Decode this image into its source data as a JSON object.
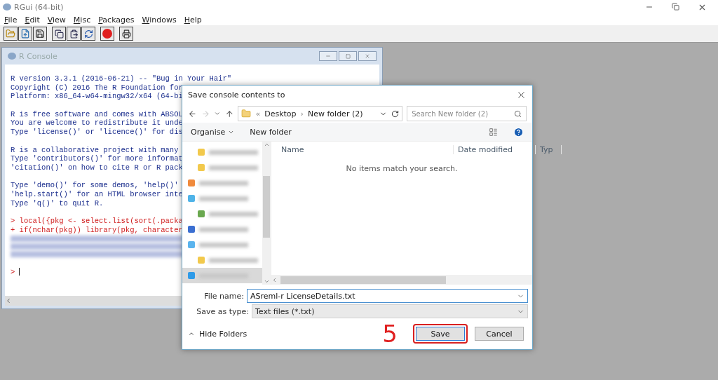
{
  "app_window": {
    "title": "RGui (64-bit)"
  },
  "menu": [
    "File",
    "Edit",
    "View",
    "Misc",
    "Packages",
    "Windows",
    "Help"
  ],
  "toolbar": [
    {
      "kind": "open"
    },
    {
      "kind": "load"
    },
    {
      "kind": "save"
    },
    {
      "kind": "copy"
    },
    {
      "kind": "paste"
    },
    {
      "kind": "refresh"
    },
    {
      "kind": "stop"
    },
    {
      "kind": "print"
    }
  ],
  "console": {
    "title": "R Console",
    "lines": [
      {
        "kind": "output",
        "text": "R version 3.3.1 (2016-06-21) -- \"Bug in Your Hair\""
      },
      {
        "kind": "output",
        "text": "Copyright (C) 2016 The R Foundation for"
      },
      {
        "kind": "output",
        "text": "Platform: x86_64-w64-mingw32/x64 (64-bi"
      },
      {
        "kind": "blank"
      },
      {
        "kind": "output",
        "text": "R is free software and comes with ABSOL"
      },
      {
        "kind": "output",
        "text": "You are welcome to redistribute it unde"
      },
      {
        "kind": "output",
        "text": "Type 'license()' or 'licence()' for dis"
      },
      {
        "kind": "blank"
      },
      {
        "kind": "output",
        "text": "R is a collaborative project with many"
      },
      {
        "kind": "output",
        "text": "Type 'contributors()' for more informat"
      },
      {
        "kind": "output",
        "text": "'citation()' on how to cite R or R pack"
      },
      {
        "kind": "blank"
      },
      {
        "kind": "output",
        "text": "Type 'demo()' for some demos, 'help()'"
      },
      {
        "kind": "output",
        "text": "'help.start()' for an HTML browser inte"
      },
      {
        "kind": "output",
        "text": "Type 'q()' to quit R."
      },
      {
        "kind": "blank"
      },
      {
        "kind": "input",
        "text": "> local({pkg <- select.list(sort(.packa"
      },
      {
        "kind": "input",
        "text": "+ if(nchar(pkg)) library(pkg, character"
      },
      {
        "kind": "blurred"
      },
      {
        "kind": "blurred"
      },
      {
        "kind": "blurred"
      },
      {
        "kind": "blank"
      },
      {
        "kind": "prompt",
        "text": ">"
      }
    ]
  },
  "dialog": {
    "title": "Save console contents to",
    "address": {
      "overflow": "«",
      "separator": "›",
      "path": [
        "Desktop",
        "New folder (2)"
      ]
    },
    "search": {
      "placeholder": "Search New folder (2)"
    },
    "commands": [
      "Organise",
      "New folder"
    ],
    "nav_items": [
      {
        "kind": "child",
        "color": "#f2c94c",
        "selected": false
      },
      {
        "kind": "child",
        "color": "#f2c94c",
        "selected": false
      },
      {
        "kind": "top",
        "color": "#f08a3c",
        "selected": false
      },
      {
        "kind": "top",
        "color": "#4fb3e8",
        "selected": false
      },
      {
        "kind": "child",
        "color": "#6aa84f",
        "selected": false
      },
      {
        "kind": "top",
        "color": "#3b6fd1",
        "selected": false
      },
      {
        "kind": "top",
        "color": "#5ab4ee",
        "selected": false
      },
      {
        "kind": "child",
        "color": "#f2c94c",
        "selected": false
      },
      {
        "kind": "top",
        "color": "#2f9be8",
        "selected": true
      }
    ],
    "columns": [
      "Name",
      "Date modified",
      "Typ"
    ],
    "empty_message": "No items match your search.",
    "file_name": {
      "label": "File name:",
      "value": "ASreml-r LicenseDetails.txt"
    },
    "save_type": {
      "label": "Save as type:",
      "value": "Text files (*.txt)"
    },
    "hide_folders": "Hide Folders",
    "step_number": "5",
    "buttons": [
      {
        "label": "Save",
        "highlighted": true
      },
      {
        "label": "Cancel",
        "highlighted": false
      }
    ]
  }
}
